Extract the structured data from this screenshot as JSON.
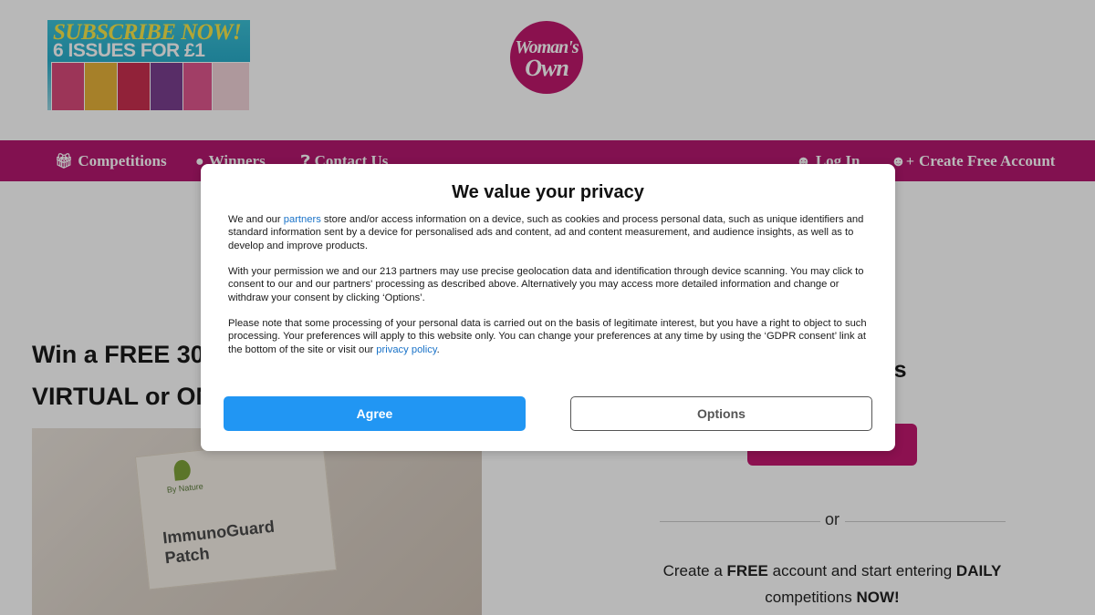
{
  "header": {
    "promo": {
      "line1": "SUBSCRIBE NOW!",
      "line2": "6 ISSUES FOR £1"
    },
    "logo": {
      "line1": "Woman's",
      "line2": "Own"
    }
  },
  "nav": {
    "left": [
      {
        "label": "Competitions",
        "icon": "gift-icon"
      },
      {
        "label": "Winners",
        "icon": "map-pin-icon"
      },
      {
        "label": "Contact Us",
        "icon": "question-circle-icon"
      }
    ],
    "right": [
      {
        "label": "Log In",
        "icon": "user-icon"
      },
      {
        "label": "Create Free Account",
        "icon": "user-plus-icon"
      }
    ]
  },
  "main": {
    "headline_line1": "Win a FREE 30-",
    "headline_line2": "VIRTUAL or ON",
    "hero": {
      "patch_brand": "By Nature",
      "patch_title_1": "ImmunoGuard",
      "patch_title_2": "Patch"
    }
  },
  "sidebar": {
    "heading_fragment": "ers",
    "or_text": "or",
    "cta_line1_a": "Create a ",
    "cta_line1_b": "FREE",
    "cta_line1_c": " account and start entering ",
    "cta_line1_d": "DAILY",
    "cta_line2_a": "competitions ",
    "cta_line2_b": "NOW!"
  },
  "consent": {
    "title": "We value your privacy",
    "para1_a": "We and our ",
    "para1_link": "partners",
    "para1_b": " store and/or access information on a device, such as cookies and process personal data, such as unique identifiers and standard information sent by a device for personalised ads and content, ad and content measurement, and audience insights, as well as to develop and improve products.",
    "para2": "With your permission we and our 213 partners may use precise geolocation data and identification through device scanning. You may click to consent to our and our partners' processing as described above. Alternatively you may access more detailed information and change or withdraw your consent by clicking ‘Options’.",
    "para3_a": "Please note that some processing of your personal data is carried out on the basis of legitimate interest, but you have a right to object to such processing. Your preferences will apply to this website only. You can change your preferences at any time by using the ‘GDPR consent’ link at the bottom of the site or visit our ",
    "para3_link": "privacy policy",
    "para3_b": ".",
    "agree_label": "Agree",
    "options_label": "Options"
  },
  "colors": {
    "brand_magenta": "#b5186f",
    "agree_blue": "#2196f3",
    "link_blue": "#1a73c8"
  }
}
